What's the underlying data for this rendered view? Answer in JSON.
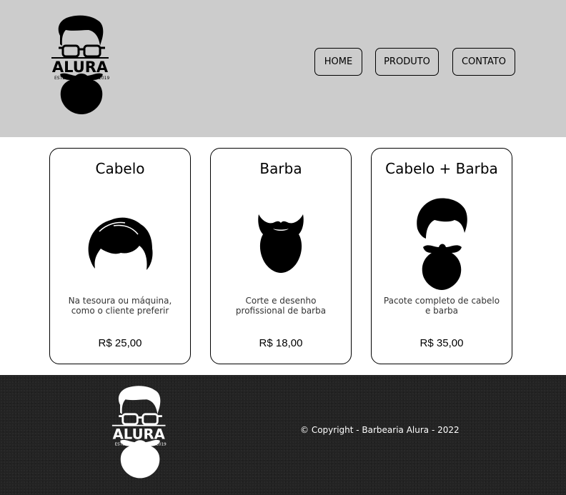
{
  "brand": {
    "logo_text": "ALURA",
    "logo_estd": "ESTD",
    "logo_year": "2019"
  },
  "nav": {
    "home": "HOME",
    "produto": "PRODUTO",
    "contato": "CONTATO"
  },
  "cards": [
    {
      "title": "Cabelo",
      "description": "Na tesoura ou máquina, como o cliente preferir",
      "price": "R$ 25,00",
      "icon": "hair-icon"
    },
    {
      "title": "Barba",
      "description": "Corte e desenho profissional de barba",
      "price": "R$ 18,00",
      "icon": "beard-icon"
    },
    {
      "title": "Cabelo + Barba",
      "description": "Pacote completo de cabelo e barba",
      "price": "R$ 35,00",
      "icon": "hair-beard-icon"
    }
  ],
  "footer": {
    "copyright": "© Copyright - Barbearia Alura - 2022"
  },
  "colors": {
    "header_bg": "#cccccc",
    "footer_bg": "#232323",
    "text": "#000000"
  }
}
